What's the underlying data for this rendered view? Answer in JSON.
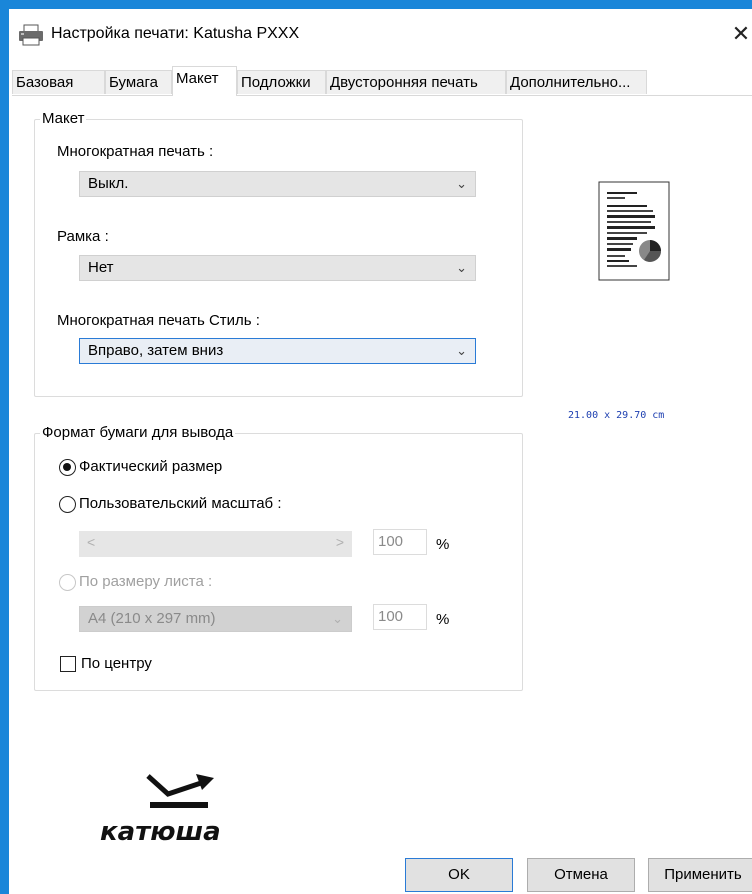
{
  "window": {
    "title": "Настройка печати: Katusha PXXX",
    "close_glyph": "✕"
  },
  "tabs": [
    {
      "label": "Базовая"
    },
    {
      "label": "Бумага"
    },
    {
      "label": "Макет"
    },
    {
      "label": "Подложки"
    },
    {
      "label": "Двусторонняя печать"
    },
    {
      "label": "Дополнительно..."
    }
  ],
  "layout_group": {
    "title": "Макет",
    "multi_print_label": "Многократная печать :",
    "multi_print_value": "Выкл.",
    "border_label": "Рамка :",
    "border_value": "Нет",
    "multi_style_label": "Многократная печать Стиль :",
    "multi_style_value": "Вправо, затем вниз"
  },
  "paper_group": {
    "title": "Формат бумаги для вывода",
    "actual_size_label": "Фактический размер",
    "actual_size_checked": true,
    "custom_scale_label": "Пользовательский масштаб :",
    "custom_scale_checked": false,
    "custom_scale_value": "100",
    "fit_page_label": "По размеру листа :",
    "fit_page_checked": false,
    "fit_page_value": "A4 (210 x 297 mm)",
    "fit_page_percent": "100",
    "percent_sign": "%",
    "center_label": "По центру",
    "center_checked": false
  },
  "preview": {
    "size_text": "21.00 x 29.70 cm"
  },
  "logo": {
    "text": "катюша"
  },
  "buttons": {
    "ok": "OK",
    "cancel": "Отмена",
    "apply": "Применить"
  },
  "colors": {
    "window_border": "#1a86d9",
    "focus_border": "#2a7bd6",
    "size_text": "#1d3fb0"
  }
}
